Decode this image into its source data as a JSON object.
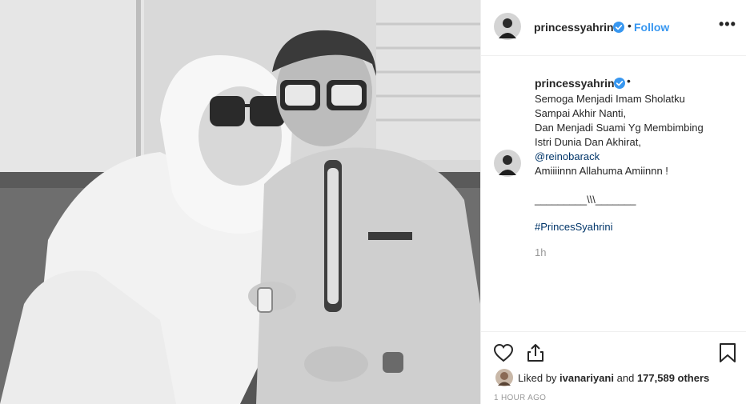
{
  "post": {
    "username": "princessyahrini",
    "follow_label": "Follow",
    "separator": "•",
    "more_label": "•••"
  },
  "caption": {
    "username": "princessyahrini",
    "separator": "•",
    "lines": [
      "Semoga Menjadi Imam Sholatku",
      "Sampai Akhir Nanti,",
      "Dan Menjadi Suami Yg Membimbing",
      "Istri Dunia Dan Akhirat,"
    ],
    "mention": "@reinobarack",
    "line_after_mention": "Amiiiinnn Allahuma Amiinnn !",
    "divider": "_________\\\\\\_______",
    "hashtag": "#PrincesSyahrini",
    "time": "1h"
  },
  "engagement": {
    "liked_by_prefix": "Liked by",
    "liker": "ivanariyani",
    "and_word": "and",
    "others": "177,589 others",
    "posted_ago": "1 HOUR AGO"
  },
  "icons": {
    "verified": "verified-badge-icon",
    "like": "heart-icon",
    "share": "share-icon",
    "save": "bookmark-icon",
    "more": "more-options-icon"
  },
  "colors": {
    "link": "#3897f0",
    "mention": "#003569",
    "muted": "#999999",
    "verified": "#3897f0"
  }
}
